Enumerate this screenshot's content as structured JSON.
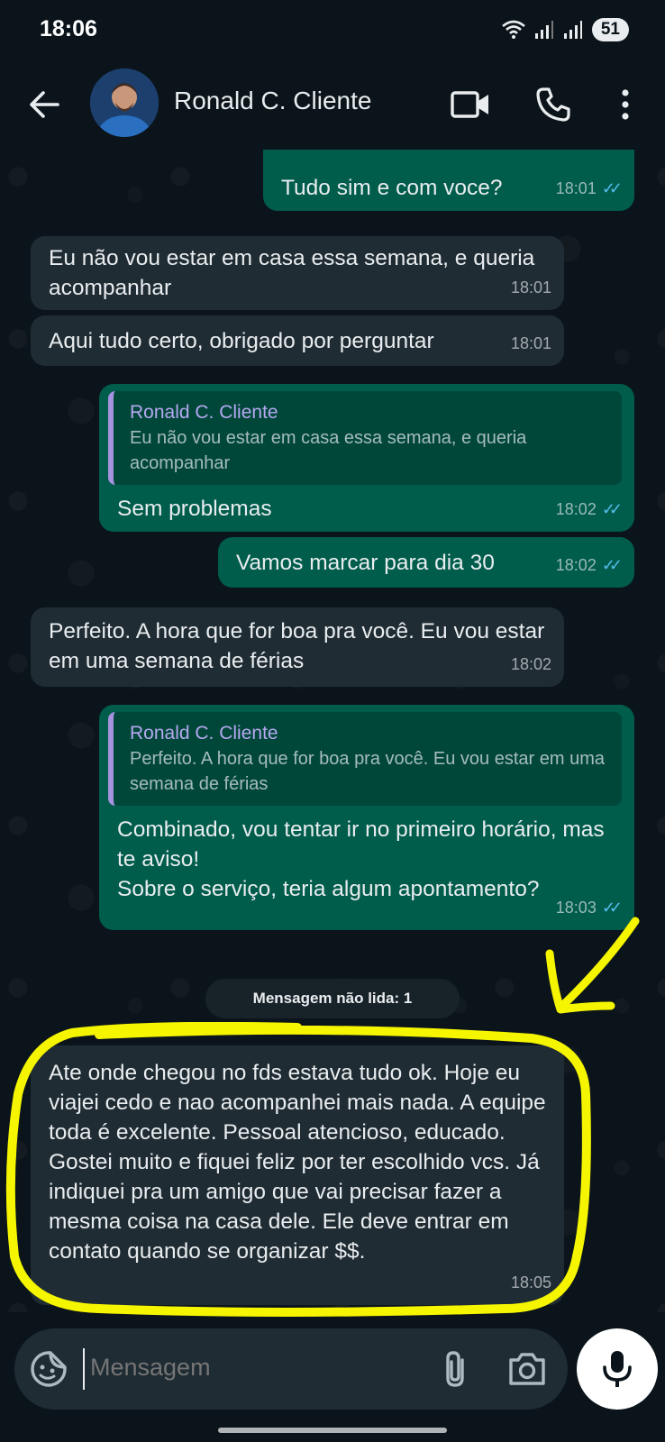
{
  "status_bar": {
    "time": "18:06",
    "battery": "51"
  },
  "header": {
    "contact_name": "Ronald C. Cliente"
  },
  "messages": [
    {
      "direction": "out",
      "text": "Tudo sim e com voce?",
      "time": "18:01"
    },
    {
      "direction": "in",
      "text": "Eu não vou estar em casa essa semana, e queria acompanhar",
      "time": "18:01"
    },
    {
      "direction": "in",
      "text": "Aqui tudo certo, obrigado por perguntar",
      "time": "18:01"
    },
    {
      "direction": "out",
      "quote_name": "Ronald C. Cliente",
      "quote_text": "Eu não vou estar em casa essa semana, e queria acompanhar",
      "text": "Sem problemas",
      "time": "18:02"
    },
    {
      "direction": "out",
      "text": "Vamos marcar para dia 30",
      "time": "18:02"
    },
    {
      "direction": "in",
      "text": "Perfeito. A hora que for boa pra você. Eu vou estar em uma semana de férias",
      "time": "18:02"
    },
    {
      "direction": "out",
      "quote_name": "Ronald C. Cliente",
      "quote_text": "Perfeito. A hora que for boa pra você. Eu vou estar em uma semana de férias",
      "text": "Combinado, vou tentar ir no primeiro horário, mas te aviso!\nSobre o serviço, teria algum apontamento?",
      "time": "18:03"
    },
    {
      "direction": "in",
      "text": "Ate onde chegou no fds estava tudo ok. Hoje eu viajei cedo e nao acompanhei mais nada. A equipe toda é excelente. Pessoal atencioso, educado. Gostei muito e fiquei feliz por ter escolhido vcs. Já indiquei pra um amigo que vai precisar fazer a mesma coisa na casa dele. Ele deve entrar em contato quando se organizar $$.",
      "time": "18:05"
    }
  ],
  "unread_label": "Mensagem não lida: 1",
  "input": {
    "placeholder": "Mensagem"
  },
  "icons": {
    "back": "arrow-left-icon",
    "video": "video-camera-icon",
    "call": "phone-icon",
    "menu": "more-vert-icon",
    "emoji": "sticker-icon",
    "attach": "paperclip-icon",
    "camera": "camera-icon",
    "mic": "microphone-icon",
    "read": "double-check-icon",
    "wifi": "wifi-icon",
    "signal": "signal-icon"
  },
  "colors": {
    "background": "#0b141a",
    "incoming": "#202c33",
    "outgoing": "#005c4b",
    "read_ticks": "#53bdeb",
    "highlight": "#f5f500"
  }
}
